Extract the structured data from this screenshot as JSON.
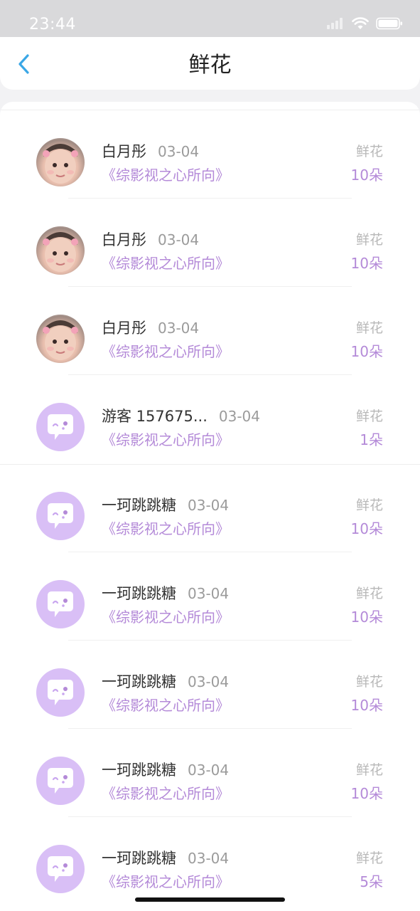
{
  "status_bar": {
    "time": "23:44"
  },
  "nav": {
    "title": "鲜花",
    "back_icon": "chevron-left-icon",
    "accent_color": "#3aa7e6"
  },
  "colors": {
    "gift_purple": "#b48ad8",
    "guest_avatar_bg": "#d9bff6"
  },
  "records": [
    {
      "name": "白月彤",
      "date": "03-04",
      "book": "《综影视之心所向》",
      "gift_label": "鲜花",
      "gift_count": "10朵",
      "avatar": "photo"
    },
    {
      "name": "白月彤",
      "date": "03-04",
      "book": "《综影视之心所向》",
      "gift_label": "鲜花",
      "gift_count": "10朵",
      "avatar": "photo"
    },
    {
      "name": "白月彤",
      "date": "03-04",
      "book": "《综影视之心所向》",
      "gift_label": "鲜花",
      "gift_count": "10朵",
      "avatar": "photo"
    },
    {
      "name": "游客 157675...",
      "date": "03-04",
      "book": "《综影视之心所向》",
      "gift_label": "鲜花",
      "gift_count": "1朵",
      "avatar": "guest"
    },
    {
      "name": "一珂跳跳糖",
      "date": "03-04",
      "book": "《综影视之心所向》",
      "gift_label": "鲜花",
      "gift_count": "10朵",
      "avatar": "guest"
    },
    {
      "name": "一珂跳跳糖",
      "date": "03-04",
      "book": "《综影视之心所向》",
      "gift_label": "鲜花",
      "gift_count": "10朵",
      "avatar": "guest"
    },
    {
      "name": "一珂跳跳糖",
      "date": "03-04",
      "book": "《综影视之心所向》",
      "gift_label": "鲜花",
      "gift_count": "10朵",
      "avatar": "guest"
    },
    {
      "name": "一珂跳跳糖",
      "date": "03-04",
      "book": "《综影视之心所向》",
      "gift_label": "鲜花",
      "gift_count": "10朵",
      "avatar": "guest"
    },
    {
      "name": "一珂跳跳糖",
      "date": "03-04",
      "book": "《综影视之心所向》",
      "gift_label": "鲜花",
      "gift_count": "5朵",
      "avatar": "guest"
    }
  ]
}
